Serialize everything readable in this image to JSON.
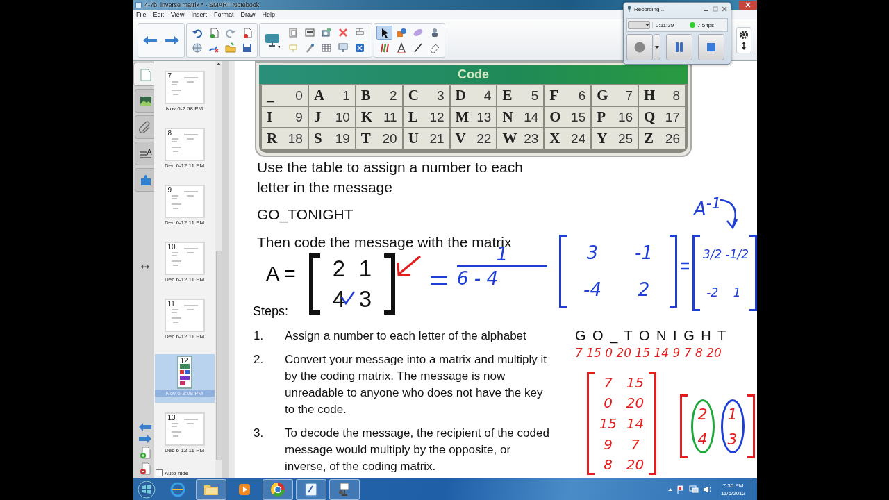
{
  "window": {
    "title": "4-7b  inverse matrix * - SMART Notebook"
  },
  "menu": [
    "File",
    "Edit",
    "View",
    "Insert",
    "Format",
    "Draw",
    "Help"
  ],
  "sidebar_tabs": [
    {
      "selected": true
    },
    {
      "selected": false
    },
    {
      "selected": false
    },
    {
      "selected": false
    },
    {
      "selected": false
    }
  ],
  "pages": [
    {
      "number": "7",
      "date": "Nov 6-2:58 PM",
      "selected": false,
      "kind": "landscape"
    },
    {
      "number": "8",
      "date": "Dec 6-12:11 PM",
      "selected": false,
      "kind": "landscape"
    },
    {
      "number": "9",
      "date": "Dec 6-12:11 PM",
      "selected": false,
      "kind": "landscape"
    },
    {
      "number": "10",
      "date": "Dec 6-12:11 PM",
      "selected": false,
      "kind": "landscape"
    },
    {
      "number": "11",
      "date": "Dec 6-12:11 PM",
      "selected": false,
      "kind": "landscape"
    },
    {
      "number": "12",
      "date": "Nov 6-3:08 PM",
      "selected": true,
      "kind": "portrait"
    },
    {
      "number": "13",
      "date": "Dec 6-12:11 PM",
      "selected": false,
      "kind": "landscape"
    }
  ],
  "auto_hide": {
    "label": "Auto-hide",
    "checked": false
  },
  "recorder": {
    "title": "Recording...",
    "elapsed": "0:11:39",
    "fps": "7.5 fps"
  },
  "code_table": {
    "title": "Code",
    "cells": [
      {
        "letter": "_",
        "number": "0"
      },
      {
        "letter": "A",
        "number": "1"
      },
      {
        "letter": "B",
        "number": "2"
      },
      {
        "letter": "C",
        "number": "3"
      },
      {
        "letter": "D",
        "number": "4"
      },
      {
        "letter": "E",
        "number": "5"
      },
      {
        "letter": "F",
        "number": "6"
      },
      {
        "letter": "G",
        "number": "7"
      },
      {
        "letter": "H",
        "number": "8"
      },
      {
        "letter": "I",
        "number": "9"
      },
      {
        "letter": "J",
        "number": "10"
      },
      {
        "letter": "K",
        "number": "11"
      },
      {
        "letter": "L",
        "number": "12"
      },
      {
        "letter": "M",
        "number": "13"
      },
      {
        "letter": "N",
        "number": "14"
      },
      {
        "letter": "O",
        "number": "15"
      },
      {
        "letter": "P",
        "number": "16"
      },
      {
        "letter": "Q",
        "number": "17"
      },
      {
        "letter": "R",
        "number": "18"
      },
      {
        "letter": "S",
        "number": "19"
      },
      {
        "letter": "T",
        "number": "20"
      },
      {
        "letter": "U",
        "number": "21"
      },
      {
        "letter": "V",
        "number": "22"
      },
      {
        "letter": "W",
        "number": "23"
      },
      {
        "letter": "X",
        "number": "24"
      },
      {
        "letter": "Y",
        "number": "25"
      },
      {
        "letter": "Z",
        "number": "26"
      }
    ]
  },
  "canvas": {
    "instruction": "Use the table to assign a number to each letter in the message",
    "message": "GO_TONIGHT",
    "direction": "Then code the message with the matrix",
    "matrix_label": "A =",
    "matrix": [
      [
        "2",
        "1"
      ],
      [
        "4",
        "3"
      ]
    ],
    "steps_title": "Steps:",
    "steps": [
      {
        "number": "1.",
        "text": "Assign a number to each letter of the alphabet"
      },
      {
        "number": "2.",
        "text": "Convert your message into a matrix and multiply it by the coding matrix.  The message is now unreadable to anyone who does not have the key to the code."
      },
      {
        "number": "3.",
        "text": "To decode the message, the recipient of the coded message would multiply by the opposite, or inverse, of the coding matrix."
      }
    ],
    "spaced_message": "G O _ T O N I G H T"
  },
  "ink": [
    {
      "kind": "label",
      "text": "A$^{-1}$",
      "color": "#1e3ed6"
    },
    {
      "kind": "curved_arrow",
      "color": "#1e3ed6"
    },
    {
      "kind": "arrow",
      "color": "#e41e1e"
    },
    {
      "kind": "tick",
      "color": "#1e3ed6"
    },
    {
      "kind": "equals",
      "color": "#1e3ed6"
    },
    {
      "kind": "fraction",
      "numerator": "1",
      "denominator": "6 - 4",
      "color": "#1e3ed6"
    },
    {
      "kind": "matrix",
      "rows": [
        [
          "3",
          "-1"
        ],
        [
          "-4",
          "2"
        ]
      ],
      "color": "#1e3ed6"
    },
    {
      "kind": "equals",
      "color": "#1e3ed6"
    },
    {
      "kind": "matrix",
      "rows": [
        [
          "3/2",
          "-1/2"
        ],
        [
          "-2",
          "1"
        ]
      ],
      "color": "#1e3ed6"
    },
    {
      "kind": "label",
      "text": "7 15 0 20 15 14 9 7 8 20",
      "color": "#e41e1e"
    },
    {
      "kind": "matrix",
      "rows": [
        [
          "7",
          "15"
        ],
        [
          "0",
          "20"
        ],
        [
          "15",
          "14"
        ],
        [
          "9",
          "7"
        ],
        [
          "8",
          "20"
        ]
      ],
      "color": "#e41e1e"
    },
    {
      "kind": "circled_matrix",
      "color": "#e41e1e",
      "columns": [
        {
          "values": [
            "2",
            "4"
          ],
          "color": "#1ea83c"
        },
        {
          "values": [
            "1",
            "3"
          ],
          "color": "#1e3ed6"
        }
      ]
    }
  ],
  "taskbar": {
    "apps": [
      {
        "kind": "globe",
        "running": false
      },
      {
        "kind": "folder",
        "running": true
      },
      {
        "kind": "player",
        "running": false
      },
      {
        "kind": "ball",
        "running": true
      },
      {
        "kind": "notepad",
        "running": true
      },
      {
        "kind": "projector",
        "running": true
      }
    ],
    "time": "7:36 PM",
    "date": "11/6/2012"
  }
}
